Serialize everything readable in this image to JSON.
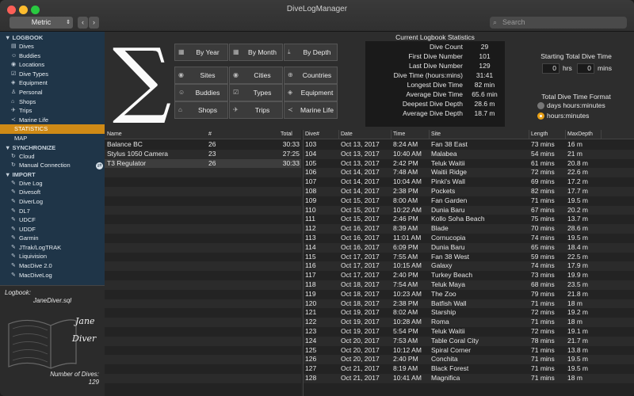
{
  "window": {
    "title": "DiveLogManager"
  },
  "toolbar": {
    "units": "Metric",
    "back_icon": "chevron-left-icon",
    "forward_icon": "chevron-right-icon",
    "search_placeholder": "Search"
  },
  "sidebar": {
    "logbook": {
      "label": "LOGBOOK",
      "items": [
        "Dives",
        "Buddies",
        "Locations",
        "Dive Types",
        "Equipment",
        "Personal",
        "Shops",
        "Trips",
        "Marine Life"
      ]
    },
    "statistics": "STATISTICS",
    "map": "MAP",
    "synchronize": {
      "label": "SYNCHRONIZE",
      "items": [
        "Cloud",
        "Manual Connection"
      ]
    },
    "import": {
      "label": "IMPORT",
      "items": [
        "Dive Log",
        "Divesoft",
        "DiverLog",
        "DL7",
        "UDCF",
        "UDDF",
        "Garmin",
        "JTrak/LogTRAK",
        "Liquivision",
        "MacDive 2.0",
        "MacDiveLog"
      ]
    }
  },
  "logbook_info": {
    "label": "Logbook:",
    "file": "JaneDiver.sql",
    "cover_line1": "Jane",
    "cover_line2": "Diver",
    "dives_label": "Number of Dives:",
    "dives_value": "129"
  },
  "stat_buttons": [
    {
      "label": "By Year",
      "icon": "calendar-icon"
    },
    {
      "label": "By Month",
      "icon": "calendar-icon"
    },
    {
      "label": "By Depth",
      "icon": "depth-icon"
    },
    {
      "label": "Sites",
      "icon": "location-icon"
    },
    {
      "label": "Cities",
      "icon": "location-icon"
    },
    {
      "label": "Countries",
      "icon": "globe-icon"
    },
    {
      "label": "Buddies",
      "icon": "buddies-icon"
    },
    {
      "label": "Types",
      "icon": "checklist-icon"
    },
    {
      "label": "Equipment",
      "icon": "mask-icon"
    },
    {
      "label": "Shops",
      "icon": "shop-icon"
    },
    {
      "label": "Trips",
      "icon": "plane-icon"
    },
    {
      "label": "Marine Life",
      "icon": "fish-icon"
    }
  ],
  "current_stats": {
    "title": "Current Logbook Statistics",
    "rows": [
      {
        "label": "Dive Count",
        "value": "29"
      },
      {
        "label": "First Dive Number",
        "value": "101"
      },
      {
        "label": "Last Dive Number",
        "value": "129"
      },
      {
        "label": "Dive Time (hours:mins)",
        "value": "31:41"
      },
      {
        "label": "Longest Dive Time",
        "value": "82 min"
      },
      {
        "label": "Average Dive Time",
        "value": "65.6 min"
      },
      {
        "label": "Deepest Dive Depth",
        "value": "28.6 m"
      },
      {
        "label": "Average Dive Depth",
        "value": "18.7 m"
      }
    ]
  },
  "starting_total": {
    "label": "Starting Total Dive Time",
    "hours": "0",
    "hours_label": "hrs",
    "mins": "0",
    "mins_label": "mins"
  },
  "time_format": {
    "label": "Total Dive Time Format",
    "option1": "days hours:minutes",
    "option2": "hours:minutes",
    "selected": "hours:minutes"
  },
  "gear_table": {
    "headers": {
      "name": "Name",
      "num": "#",
      "total": "Total"
    },
    "rows": [
      {
        "name": "Balance BC",
        "num": "26",
        "total": "30:33"
      },
      {
        "name": "Stylus 1050 Camera",
        "num": "23",
        "total": "27:25"
      },
      {
        "name": "T3 Regulator",
        "num": "26",
        "total": "30:33"
      }
    ]
  },
  "dives_table": {
    "headers": {
      "num": "Dive#",
      "date": "Date",
      "time": "Time",
      "site": "Site",
      "length": "Length",
      "depth": "MaxDepth"
    },
    "rows": [
      [
        "103",
        "Oct 13, 2017",
        "8:24 AM",
        "Fan 38 East",
        "73 mins",
        "16 m"
      ],
      [
        "104",
        "Oct 13, 2017",
        "10:40 AM",
        "Malabea",
        "54 mins",
        "21 m"
      ],
      [
        "105",
        "Oct 13, 2017",
        "2:42 PM",
        "Teluk Waitii",
        "61 mins",
        "20.8 m"
      ],
      [
        "106",
        "Oct 14, 2017",
        "7:48 AM",
        "Waitii Ridge",
        "72 mins",
        "22.6 m"
      ],
      [
        "107",
        "Oct 14, 2017",
        "10:04 AM",
        "Pinki's Wall",
        "69 mins",
        "17.2 m"
      ],
      [
        "108",
        "Oct 14, 2017",
        "2:38 PM",
        "Pockets",
        "82 mins",
        "17.7 m"
      ],
      [
        "109",
        "Oct 15, 2017",
        "8:00 AM",
        "Fan Garden",
        "71 mins",
        "19.5 m"
      ],
      [
        "110",
        "Oct 15, 2017",
        "10:22 AM",
        "Dunia Baru",
        "67 mins",
        "20.2 m"
      ],
      [
        "111",
        "Oct 15, 2017",
        "2:46 PM",
        "Kollo Soha Beach",
        "75 mins",
        "13.7 m"
      ],
      [
        "112",
        "Oct 16, 2017",
        "8:39 AM",
        "Blade",
        "70 mins",
        "28.6 m"
      ],
      [
        "113",
        "Oct 16, 2017",
        "11:01 AM",
        "Cornucopia",
        "74 mins",
        "19.5 m"
      ],
      [
        "114",
        "Oct 16, 2017",
        "6:09 PM",
        "Dunia Baru",
        "65 mins",
        "18.4 m"
      ],
      [
        "115",
        "Oct 17, 2017",
        "7:55 AM",
        "Fan 38 West",
        "59 mins",
        "22.5 m"
      ],
      [
        "116",
        "Oct 17, 2017",
        "10:15 AM",
        "Galaxy",
        "74 mins",
        "17.9 m"
      ],
      [
        "117",
        "Oct 17, 2017",
        "2:40 PM",
        "Turkey Beach",
        "73 mins",
        "19.9 m"
      ],
      [
        "118",
        "Oct 18, 2017",
        "7:54 AM",
        "Teluk Maya",
        "68 mins",
        "23.5 m"
      ],
      [
        "119",
        "Oct 18, 2017",
        "10:23 AM",
        "The Zoo",
        "79 mins",
        "21.8 m"
      ],
      [
        "120",
        "Oct 18, 2017",
        "2:38 PM",
        "Batfish Wall",
        "71 mins",
        "18 m"
      ],
      [
        "121",
        "Oct 19, 2017",
        "8:02 AM",
        "Starship",
        "72 mins",
        "19.2 m"
      ],
      [
        "122",
        "Oct 19, 2017",
        "10:28 AM",
        "Roma",
        "71 mins",
        "18 m"
      ],
      [
        "123",
        "Oct 19, 2017",
        "5:54 PM",
        "Teluk Waitii",
        "72 mins",
        "19.1 m"
      ],
      [
        "124",
        "Oct 20, 2017",
        "7:53 AM",
        "Table Coral City",
        "78 mins",
        "21.7 m"
      ],
      [
        "125",
        "Oct 20, 2017",
        "10:12 AM",
        "Spiral Corner",
        "71 mins",
        "13.8 m"
      ],
      [
        "126",
        "Oct 20, 2017",
        "2:40 PM",
        "Conchita",
        "71 mins",
        "19.5 m"
      ],
      [
        "127",
        "Oct 21, 2017",
        "8:19 AM",
        "Black Forest",
        "71 mins",
        "19.5 m"
      ],
      [
        "128",
        "Oct 21, 2017",
        "10:41 AM",
        "Magnifica",
        "71 mins",
        "18 m"
      ]
    ]
  }
}
